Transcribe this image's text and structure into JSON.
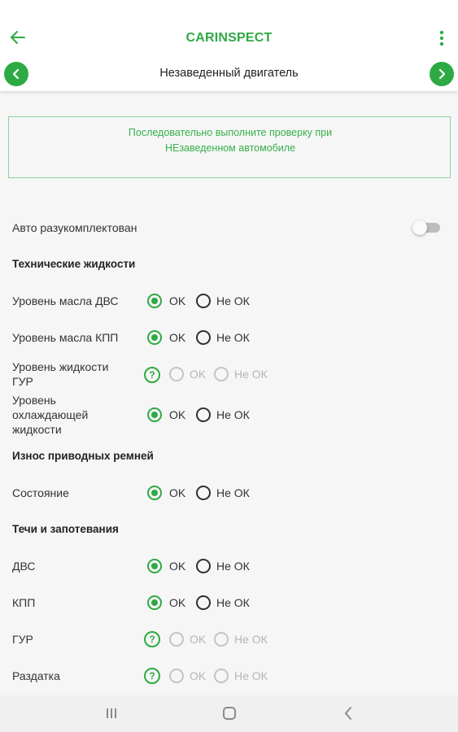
{
  "header": {
    "logo": "CARINSPECT",
    "title": "Незаведенный двигатель",
    "accent_color": "#2eaa44"
  },
  "icons": {
    "back": "back-arrow-icon",
    "menu": "more-vertical-icon",
    "prev": "chevron-left-icon",
    "next": "chevron-right-icon",
    "help": "question-mark-icon"
  },
  "notice": {
    "text": "Последовательно выполните проверку при НЕзаведенном автомобиле"
  },
  "switch": {
    "label": "Авто разукомплектован",
    "on": false
  },
  "sections": [
    {
      "title": "Технические жидкости",
      "rows": [
        {
          "label": "Уровень масла ДВС",
          "selected": "OK",
          "disabled": false
        },
        {
          "label": "Уровень масла КПП",
          "selected": "OK",
          "disabled": false
        },
        {
          "label": "Уровень жидкости ГУР",
          "selected": null,
          "disabled": true
        },
        {
          "label": "Уровень охлаждающей жидкости",
          "selected": "OK",
          "disabled": false
        }
      ]
    },
    {
      "title": "Износ приводных ремней",
      "rows": [
        {
          "label": "Состояние",
          "selected": "OK",
          "disabled": false
        }
      ]
    },
    {
      "title": "Течи и запотевания",
      "rows": [
        {
          "label": "ДВС",
          "selected": "OK",
          "disabled": false
        },
        {
          "label": "КПП",
          "selected": "OK",
          "disabled": false
        },
        {
          "label": "ГУР",
          "selected": null,
          "disabled": true
        },
        {
          "label": "Раздатка",
          "selected": null,
          "disabled": true
        }
      ]
    }
  ],
  "options": {
    "ok": "OK",
    "not_ok": "Не ОК",
    "help": "?"
  }
}
